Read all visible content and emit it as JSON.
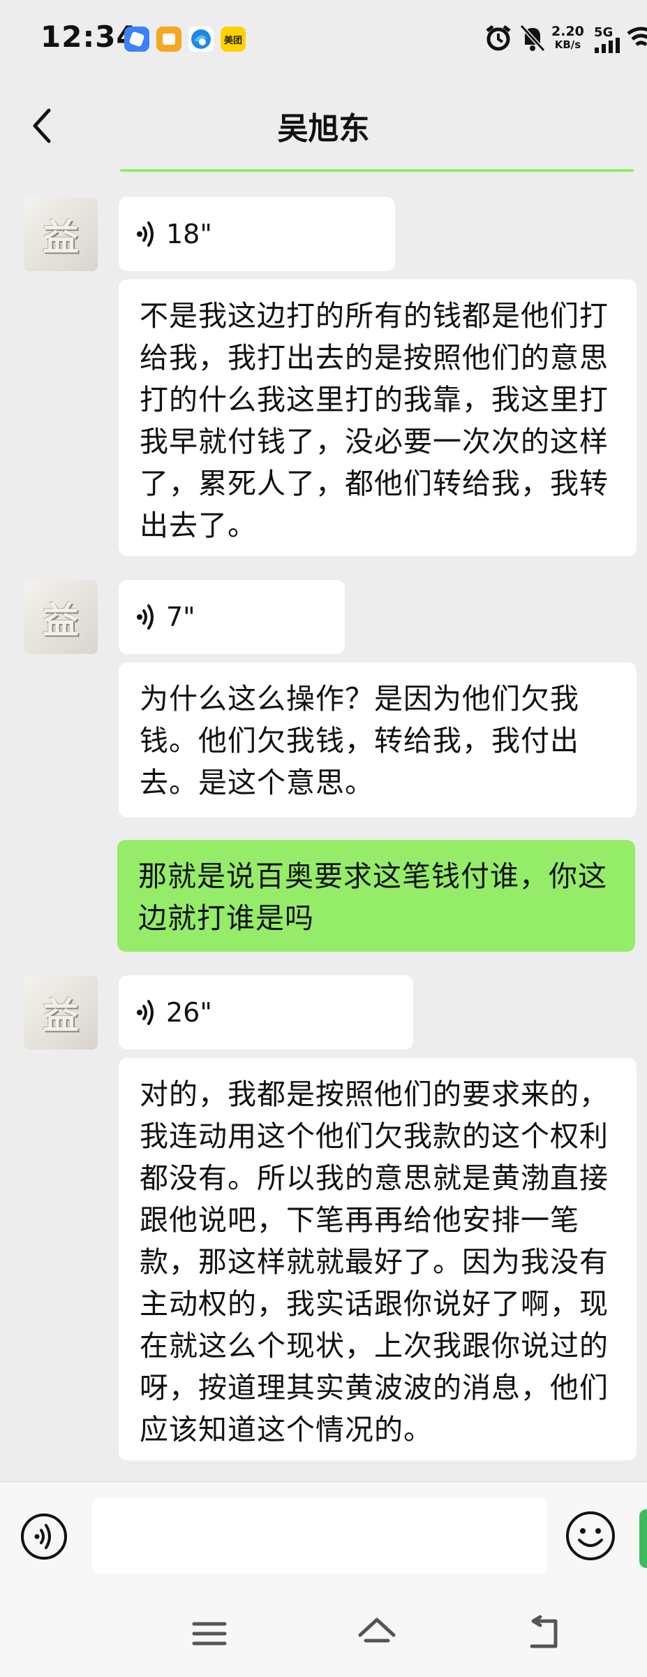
{
  "status_bar": {
    "time": "12:34",
    "app_icons": [
      {
        "name": "blue-app-icon",
        "color": "#3b82f6"
      },
      {
        "name": "orange-app-icon",
        "color": "#f5a623"
      },
      {
        "name": "edge-browser-icon",
        "color": "#1e88e5"
      },
      {
        "name": "meituan-app-icon",
        "color": "#ffd100",
        "label": "美团"
      }
    ],
    "net_speed_value": "2.20",
    "net_speed_unit": "KB/s",
    "network_type": "5G"
  },
  "nav": {
    "title": "吴旭东"
  },
  "messages": [
    {
      "type": "voice",
      "sender": "other",
      "avatar_char": "益",
      "duration": "18\""
    },
    {
      "type": "text",
      "sender": "other",
      "text": "不是我这边打的所有的钱都是他们打给我，我打出去的是按照他们的意思打的什么我这里打的我靠，我这里打我早就付钱了，没必要一次次的这样了，累死人了，都他们转给我，我转出去了。"
    },
    {
      "type": "voice",
      "sender": "other",
      "avatar_char": "益",
      "duration": "7\""
    },
    {
      "type": "text",
      "sender": "other",
      "text": "为什么这么操作？是因为他们欠我钱。他们欠我钱，转给我，我付出去。是这个意思。"
    },
    {
      "type": "text",
      "sender": "me",
      "text": "那就是说百奥要求这笔钱付谁，你这边就打谁是吗"
    },
    {
      "type": "voice",
      "sender": "other",
      "avatar_char": "益",
      "duration": "26\""
    },
    {
      "type": "text",
      "sender": "other",
      "text": "对的，我都是按照他们的要求来的，我连动用这个他们欠我款的这个权利都没有。所以我的意思就是黄渤直接跟他说吧，下笔再再给他安排一笔款，那这样就就最好了。因为我没有主动权的，我实话跟你说好了啊，现在就这么个现状，上次我跟你说过的呀，按道理其实黄波波的消息，他们应该知道这个情况的。"
    }
  ],
  "input_bar": {
    "placeholder": ""
  },
  "colors": {
    "background": "#ededed",
    "my_bubble": "#95ec69",
    "other_bubble": "#ffffff"
  }
}
